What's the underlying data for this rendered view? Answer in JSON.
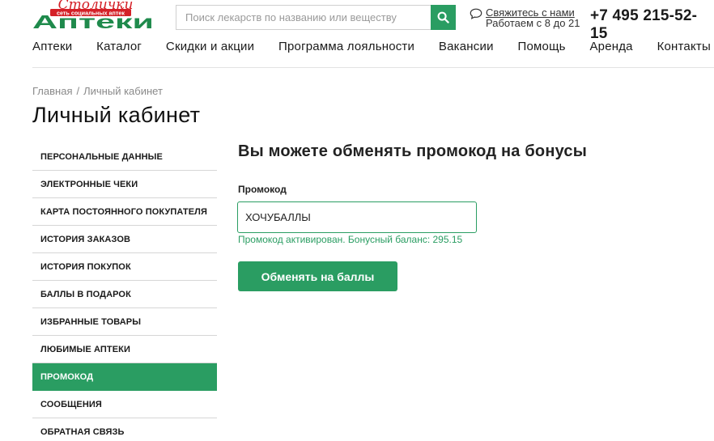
{
  "header": {
    "logo": {
      "script_text": "Столички",
      "tagline": "сеть социальных аптек",
      "wordmark": "Аптеки",
      "colors": {
        "red": "#d42027",
        "green": "#1f8a4c"
      }
    },
    "search": {
      "placeholder": "Поиск лекарств по названию или веществу",
      "icon": "search-icon"
    },
    "contact": {
      "link_label": "Свяжитесь с нами",
      "hours": "Работаем с 8 до 21",
      "icon": "chat-icon"
    },
    "phone": "+7 495 215-52-15"
  },
  "nav": [
    "Аптеки",
    "Каталог",
    "Скидки и акции",
    "Программа лояльности",
    "Вакансии",
    "Помощь",
    "Аренда",
    "Контакты"
  ],
  "breadcrumb": {
    "items": [
      "Главная",
      "Личный кабинет"
    ],
    "separator": "/"
  },
  "page_title": "Личный кабинет",
  "sidebar": {
    "items": [
      {
        "label": "ПЕРСОНАЛЬНЫЕ ДАННЫЕ",
        "active": false
      },
      {
        "label": "ЭЛЕКТРОННЫЕ ЧЕКИ",
        "active": false
      },
      {
        "label": "КАРТА ПОСТОЯННОГО ПОКУПАТЕЛЯ",
        "active": false
      },
      {
        "label": "ИСТОРИЯ ЗАКАЗОВ",
        "active": false
      },
      {
        "label": "ИСТОРИЯ ПОКУПОК",
        "active": false
      },
      {
        "label": "БАЛЛЫ В ПОДАРОК",
        "active": false
      },
      {
        "label": "ИЗБРАННЫЕ ТОВАРЫ",
        "active": false
      },
      {
        "label": "ЛЮБИМЫЕ АПТЕКИ",
        "active": false
      },
      {
        "label": "ПРОМОКОД",
        "active": true
      },
      {
        "label": "СООБЩЕНИЯ",
        "active": false
      },
      {
        "label": "ОБРАТНАЯ СВЯЗЬ",
        "active": false
      }
    ]
  },
  "main": {
    "heading": "Вы можете обменять промокод на бонусы",
    "field_label": "Промокод",
    "promo_value": "ХОЧУБАЛЛЫ",
    "status": "Промокод активирован. Бонусный баланс: 295.15",
    "button_label": "Обменять на баллы"
  },
  "colors": {
    "accent": "#2a9d62",
    "text": "#1a1a1a",
    "muted": "#8a8a8a"
  }
}
